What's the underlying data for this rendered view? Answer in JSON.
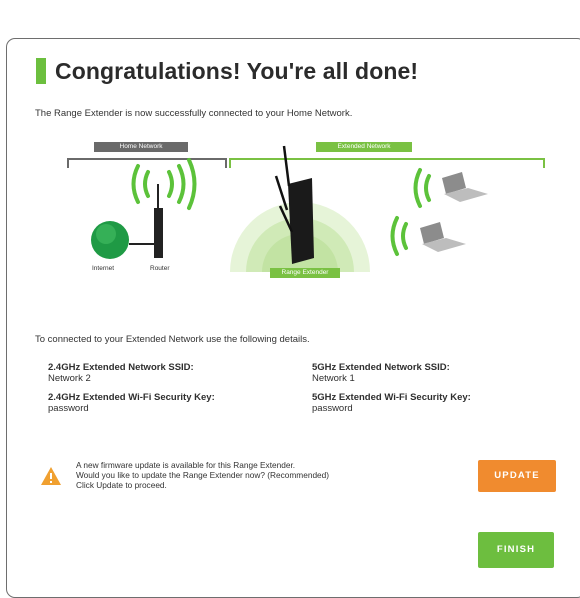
{
  "page": {
    "title": "Congratulations! You're all done!",
    "intro": "The Range Extender is now successfully connected to your Home Network."
  },
  "diagram": {
    "home_network_label": "Home Network",
    "extended_network_label": "Extended Network",
    "range_extender_label": "Range Extender",
    "internet_label": "Internet",
    "router_label": "Router"
  },
  "details": {
    "intro": "To connected to your Extended Network use the following details.",
    "ssid_24_label": "2.4GHz Extended Network SSID:",
    "ssid_24_value": "Network 2",
    "key_24_label": "2.4GHz Extended Wi-Fi Security Key:",
    "key_24_value": "password",
    "ssid_5_label": "5GHz Extended Network SSID:",
    "ssid_5_value": "Network 1",
    "key_5_label": "5GHz Extended Wi-Fi Security Key:",
    "key_5_value": "password"
  },
  "firmware": {
    "line1": "A new firmware update is available for this Range Extender.",
    "line2": "Would you like to update the Range Extender now? (Recommended)",
    "line3": "Click Update to proceed."
  },
  "buttons": {
    "update_label": "UPDATE",
    "finish_label": "FINISH"
  },
  "colors": {
    "accent_green": "#6cbf3e",
    "update_orange": "#f08b2f",
    "home_gray": "#6a6a6a",
    "warning_orange": "#f0a030"
  }
}
